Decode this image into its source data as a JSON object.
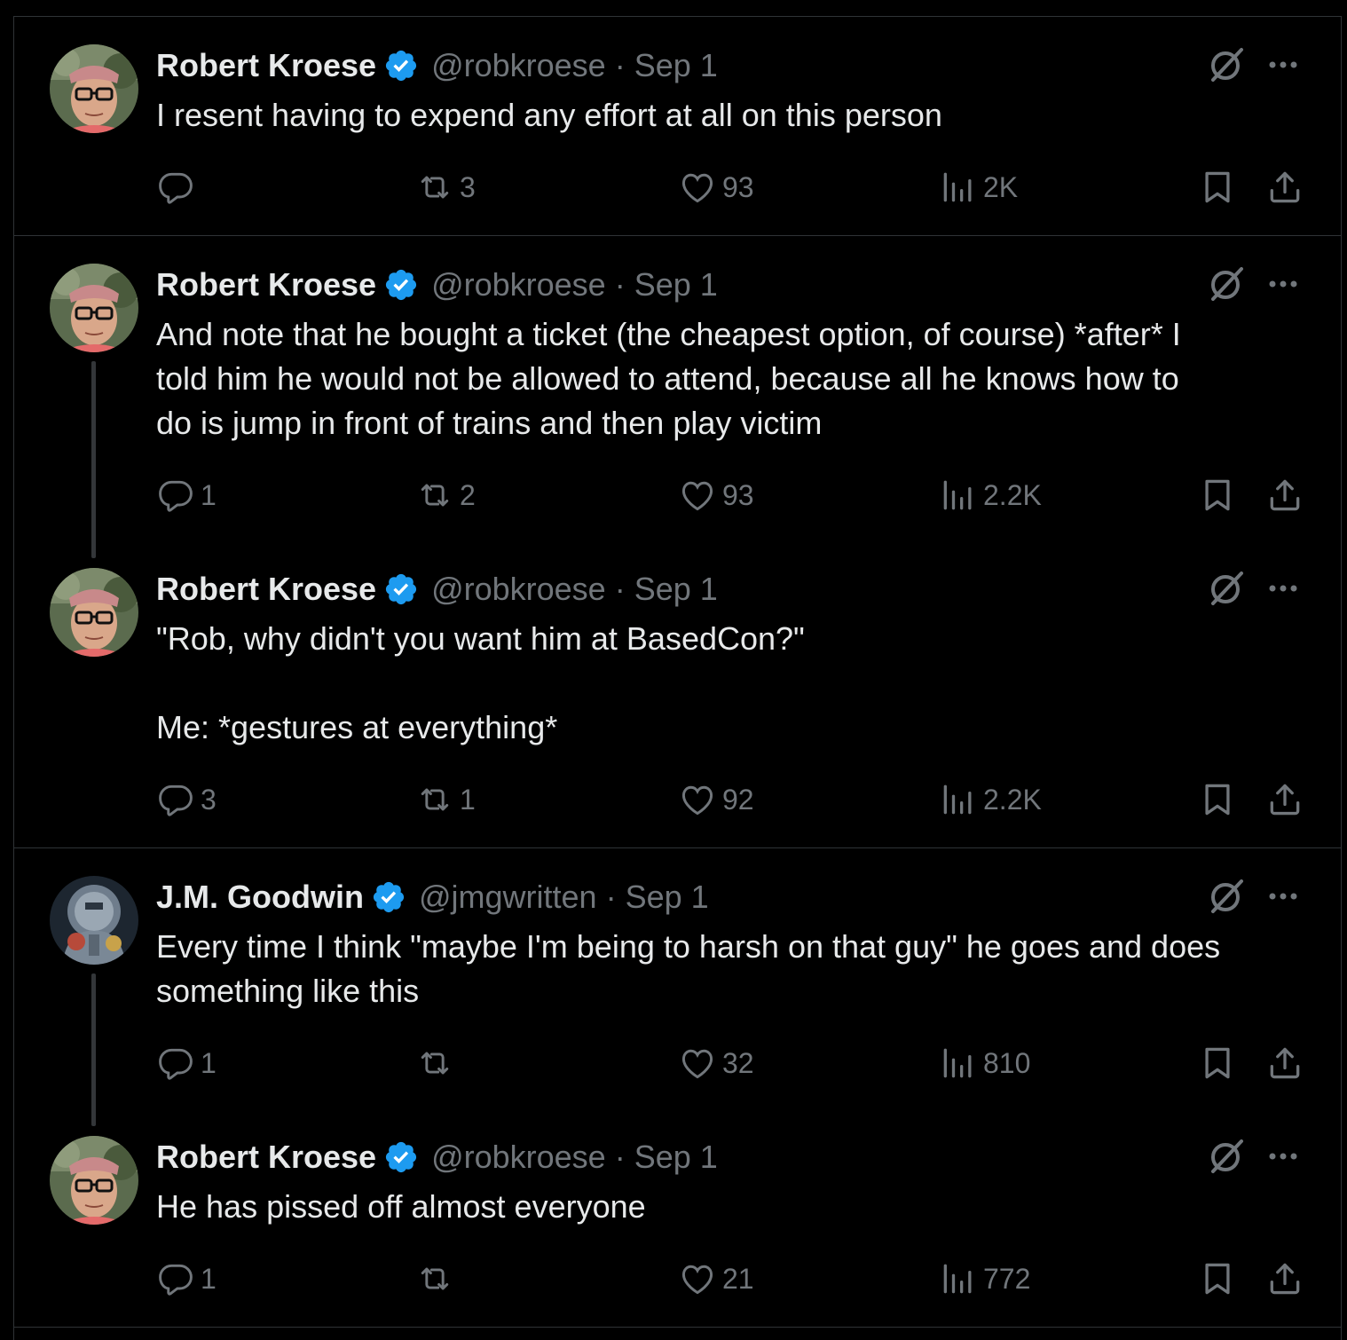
{
  "tweets": [
    {
      "name": "Robert Kroese",
      "handle": "@robkroese",
      "date": "Sep 1",
      "text": "I resent having to expend any effort at all on this person",
      "replies": "",
      "retweets": "3",
      "likes": "93",
      "views": "2K",
      "avatar": "robert-kroese-avatar"
    },
    {
      "name": "Robert Kroese",
      "handle": "@robkroese",
      "date": "Sep 1",
      "text": "And note that he bought a ticket (the cheapest option, of course) *after* I\ntold him he would not be allowed to attend, because all he knows how to\ndo is jump in front of trains and then play victim",
      "replies": "1",
      "retweets": "2",
      "likes": "93",
      "views": "2.2K",
      "avatar": "robert-kroese-avatar"
    },
    {
      "name": "Robert Kroese",
      "handle": "@robkroese",
      "date": "Sep 1",
      "text": "\"Rob, why didn't you want him at BasedCon?\"\n\nMe: *gestures at everything*",
      "replies": "3",
      "retweets": "1",
      "likes": "92",
      "views": "2.2K",
      "avatar": "robert-kroese-avatar"
    },
    {
      "name": "J.M. Goodwin",
      "handle": "@jmgwritten",
      "date": "Sep 1",
      "text": "Every time I think \"maybe I'm being to harsh on that guy\" he goes and does\nsomething like this",
      "replies": "1",
      "retweets": "",
      "likes": "32",
      "views": "810",
      "avatar": "jm-goodwin-avatar"
    },
    {
      "name": "Robert Kroese",
      "handle": "@robkroese",
      "date": "Sep 1",
      "text": "He has pissed off almost everyone",
      "replies": "1",
      "retweets": "",
      "likes": "21",
      "views": "772",
      "avatar": "robert-kroese-avatar"
    }
  ],
  "ui": {
    "separator": "·",
    "colors": {
      "background": "#000000",
      "text": "#e7e9ea",
      "muted": "#71767b",
      "verified": "#1d9bf0",
      "border": "#2f3336"
    },
    "icons": [
      "reply-icon",
      "retweet-icon",
      "like-icon",
      "views-icon",
      "bookmark-icon",
      "share-icon",
      "grok-icon",
      "more-icon",
      "verified-badge-icon"
    ]
  }
}
